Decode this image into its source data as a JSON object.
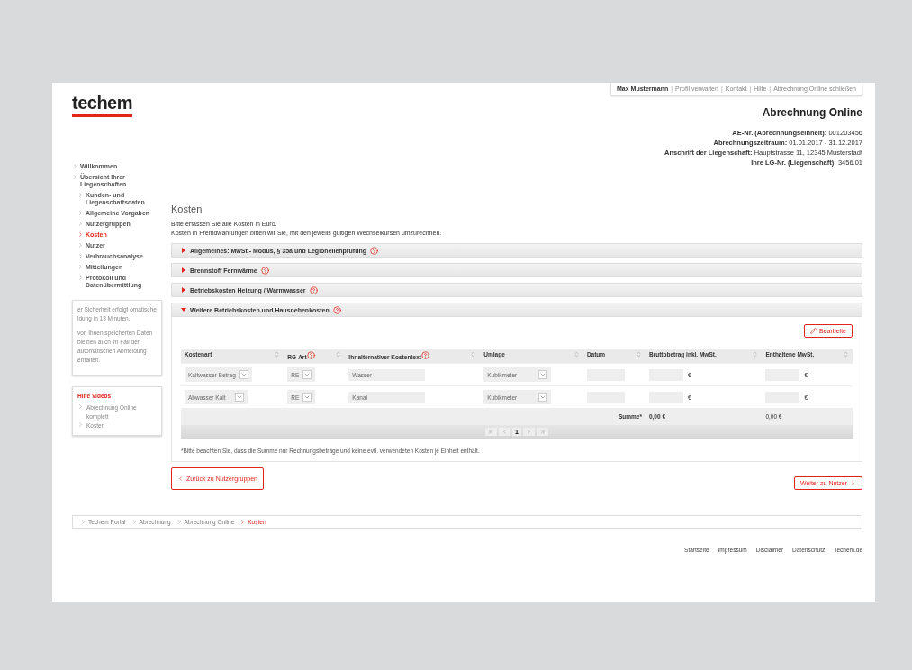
{
  "logo": "techem",
  "user_bar_separator": "|",
  "user_bar": [
    {
      "label": "Max Mustermann",
      "kind": "user"
    },
    {
      "label": "Profil verwalten",
      "kind": "link"
    },
    {
      "label": "Kontakt",
      "kind": "link"
    },
    {
      "label": "Hilfe",
      "kind": "link"
    },
    {
      "label": "Abrechnung Online schließen",
      "kind": "link"
    }
  ],
  "app_title": "Abrechnung Online",
  "details": [
    {
      "label": "AE-Nr. (Abrechnungseinheit):",
      "value": "001203456"
    },
    {
      "label": "Abrechnungszeitraum:",
      "value": "01.01.2017 - 31.12.2017"
    },
    {
      "label": "Anschrift der Liegenschaft:",
      "value": "Hauptstrasse 11, 12345 Musterstadt"
    },
    {
      "label": "Ihre LG-Nr. (Liegenschaft):",
      "value": "3456.01"
    }
  ],
  "sidebar": {
    "items": [
      {
        "label": "Willkommen",
        "selected": false
      },
      {
        "label": "Übersicht Ihrer Liegenschaften",
        "selected": false,
        "children": [
          {
            "label": "Kunden- und Liegenschaftsdaten",
            "selected": false
          },
          {
            "label": "Allgemeine Vorgaben",
            "selected": false
          },
          {
            "label": "Nutzergruppen",
            "selected": false
          },
          {
            "label": "Kosten",
            "selected": true
          },
          {
            "label": "Nutzer",
            "selected": false
          },
          {
            "label": "Verbrauchsanalyse",
            "selected": false
          },
          {
            "label": "Mitteilungen",
            "selected": false
          },
          {
            "label": "Protokoll und Datenübermittlung",
            "selected": false
          }
        ]
      }
    ],
    "info_box": [
      "er Sicherheit erfolgt omatische ldung in 13 Minuten.",
      "von Ihnen speicherten Daten bleiben auch im Fall der automatischen Abmeldung erhalten."
    ],
    "help_videos": {
      "title": "Hilfe Videos",
      "items": [
        "Abrechnung Online komplett",
        "Kosten"
      ]
    }
  },
  "page_title": "Kosten",
  "intro": [
    "Bitte erfassen Sie alle Kosten in Euro.",
    "Kosten in Fremdwährungen bitten wir Sie, mit den jeweils gültigen Wechselkursen umzurechnen."
  ],
  "sections": [
    {
      "title": "Allgemeines: MwSt.- Modus, § 35a und Legionellenprüfung",
      "expanded": false
    },
    {
      "title": "Brennstoff Fernwärme",
      "expanded": false
    },
    {
      "title": "Betriebskosten Heizung / Warmwasser",
      "expanded": false
    },
    {
      "title": "Weitere Betriebskosten und Hausnebenkosten",
      "expanded": true
    }
  ],
  "edit_button": "Bearbeite",
  "table": {
    "columns": [
      {
        "label": "Kostenart",
        "help": false
      },
      {
        "label": "RG-Art",
        "help": true
      },
      {
        "label": "Ihr alternativer Kostentext",
        "help": true
      },
      {
        "label": "Umlage",
        "help": false
      },
      {
        "label": "Datum",
        "help": false
      },
      {
        "label": "Bruttobetrag inkl. MwSt.",
        "help": false
      },
      {
        "label": "Enthaltene MwSt.",
        "help": false
      }
    ],
    "rows": [
      {
        "kostenart": "Kaltwasser Betrag",
        "rg_art": "RE",
        "text": "Wasser",
        "umlage": "Kubikmeter",
        "currency_gross": "€",
        "currency_vat": "€"
      },
      {
        "kostenart": "Abwasser Kalt",
        "rg_art": "RE",
        "text": "Kanal",
        "umlage": "Kubikmeter",
        "currency_gross": "€",
        "currency_vat": "€"
      }
    ],
    "sum_label": "Summe*",
    "sum_gross": "0,00 €",
    "sum_vat": "0,00 €",
    "page": "1"
  },
  "footnote": "*Bitte beachten Sie, dass die Summe nur Rechnungsbeträge und keine evtl. verwendeten Kosten je Einheit enthält.",
  "back_button": "Zurück zu Nutzergruppen",
  "next_button": "Weiter zu Nutzer",
  "breadcrumb": [
    {
      "label": "Techem Portal",
      "selected": false
    },
    {
      "label": "Abrechnung",
      "selected": false
    },
    {
      "label": "Abrechnung Online",
      "selected": false
    },
    {
      "label": "Kosten",
      "selected": true
    }
  ],
  "footer_links": [
    "Startseite",
    "Impressum",
    "Disclaimer",
    "Datenschutz",
    "Techem.de"
  ]
}
